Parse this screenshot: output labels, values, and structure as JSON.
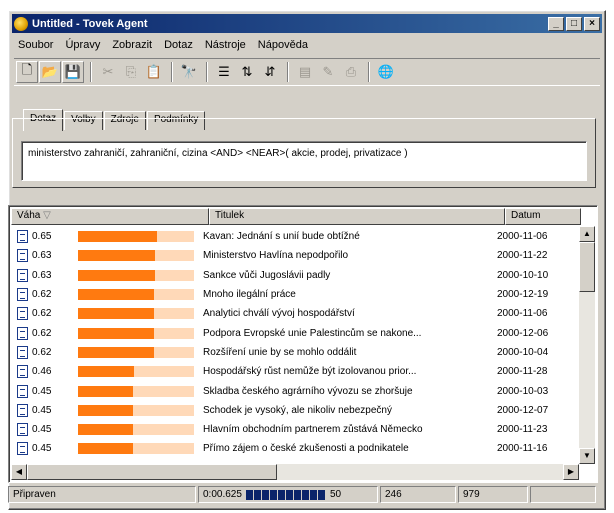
{
  "window": {
    "title": "Untitled - Tovek Agent"
  },
  "menu": [
    "Soubor",
    "Úpravy",
    "Zobrazit",
    "Dotaz",
    "Nástroje",
    "Nápověda"
  ],
  "toolbar": {
    "buttons": [
      {
        "icon": "new-file-icon",
        "glyph": "🗋",
        "enabled": true
      },
      {
        "icon": "open-folder-icon",
        "glyph": "📂",
        "enabled": true
      },
      {
        "icon": "save-icon",
        "glyph": "💾",
        "enabled": true
      },
      {
        "icon": "cut-icon",
        "glyph": "✂",
        "enabled": false
      },
      {
        "icon": "copy-icon",
        "glyph": "⎘",
        "enabled": false
      },
      {
        "icon": "paste-icon",
        "glyph": "📋",
        "enabled": true
      },
      {
        "icon": "find-icon",
        "glyph": "🔭",
        "enabled": true
      },
      {
        "icon": "list-view-icon",
        "glyph": "☰",
        "enabled": true
      },
      {
        "icon": "sort-icon",
        "glyph": "⇅",
        "enabled": true
      },
      {
        "icon": "filter-icon",
        "glyph": "⇵",
        "enabled": true
      },
      {
        "icon": "doc-view-icon",
        "glyph": "▤",
        "enabled": false
      },
      {
        "icon": "edit-doc-icon",
        "glyph": "✎",
        "enabled": false
      },
      {
        "icon": "print-icon",
        "glyph": "⎙",
        "enabled": false
      },
      {
        "icon": "globe-icon",
        "glyph": "🌐",
        "enabled": true
      }
    ]
  },
  "tabs": [
    "Dotaz",
    "Volby",
    "Zdroje",
    "Podmínky"
  ],
  "query": "ministerstvo zahraničí, zahraniční, cizina <AND> <NEAR>( akcie, prodej, privatizace )",
  "columns": {
    "weight": "Váha",
    "title": "Titulek",
    "date": "Datum"
  },
  "rows": [
    {
      "weight": "0.65",
      "pct": 0.65,
      "title": "Kavan: Jednání s unií bude obtížné",
      "date": "2000-11-06"
    },
    {
      "weight": "0.63",
      "pct": 0.63,
      "title": "Ministerstvo Havlína nepodpořilo",
      "date": "2000-11-22"
    },
    {
      "weight": "0.63",
      "pct": 0.63,
      "title": "Sankce vůči Jugoslávii padly",
      "date": "2000-10-10"
    },
    {
      "weight": "0.62",
      "pct": 0.62,
      "title": "Mnoho ilegální práce",
      "date": "2000-12-19"
    },
    {
      "weight": "0.62",
      "pct": 0.62,
      "title": "Analytici chválí vývoj hospodářství",
      "date": "2000-11-06"
    },
    {
      "weight": "0.62",
      "pct": 0.62,
      "title": "Podpora Evropské unie Palestincům se nakone...",
      "date": "2000-12-06"
    },
    {
      "weight": "0.62",
      "pct": 0.62,
      "title": "Rozšíření unie by se mohlo oddálit",
      "date": "2000-10-04"
    },
    {
      "weight": "0.46",
      "pct": 0.46,
      "title": "Hospodářský růst nemůže být izolovanou prior...",
      "date": "2000-11-28"
    },
    {
      "weight": "0.45",
      "pct": 0.45,
      "title": "Skladba českého agrárního vývozu se zhoršuje",
      "date": "2000-10-03"
    },
    {
      "weight": "0.45",
      "pct": 0.45,
      "title": "Schodek je vysoký, ale nikoliv nebezpečný",
      "date": "2000-12-07"
    },
    {
      "weight": "0.45",
      "pct": 0.45,
      "title": "Hlavním obchodním partnerem zůstává Německo",
      "date": "2000-11-23"
    },
    {
      "weight": "0.45",
      "pct": 0.45,
      "title": "Přímo zájem o české zkušenosti a podnikatele",
      "date": "2000-11-16"
    }
  ],
  "status": {
    "state": "Připraven",
    "time": "0:00.625",
    "progress_value": "50",
    "count": "246",
    "total": "979"
  }
}
